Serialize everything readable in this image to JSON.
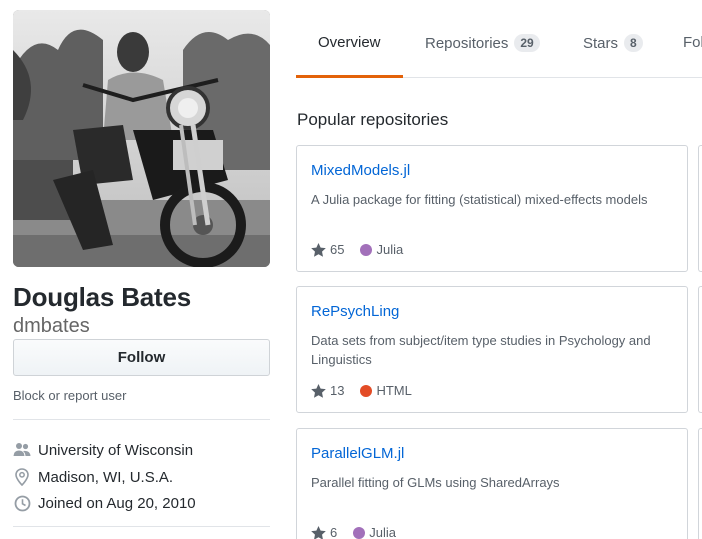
{
  "profile": {
    "full_name": "Douglas Bates",
    "username": "dmbates",
    "follow_label": "Follow",
    "block_label": "Block or report user",
    "details": [
      {
        "icon": "organization-icon",
        "text": "University of Wisconsin"
      },
      {
        "icon": "location-icon",
        "text": "Madison, WI, U.S.A."
      },
      {
        "icon": "clock-icon",
        "text": "Joined on Aug 20, 2010"
      }
    ]
  },
  "tabs": [
    {
      "label": "Overview",
      "selected": true
    },
    {
      "label": "Repositories",
      "count": "29"
    },
    {
      "label": "Stars",
      "count": "8"
    },
    {
      "label": "Fol"
    }
  ],
  "popular": {
    "title": "Popular repositories",
    "repos": [
      {
        "name": "MixedModels.jl",
        "description": "A Julia package for fitting (statistical) mixed-effects models",
        "stars": "65",
        "language": "Julia",
        "lang_color": "#a270ba"
      },
      {
        "name": "RePsychLing",
        "description": "Data sets from subject/item type studies in Psychology and Linguistics",
        "stars": "13",
        "language": "HTML",
        "lang_color": "#e34c26"
      },
      {
        "name": "ParallelGLM.jl",
        "description": "Parallel fitting of GLMs using SharedArrays",
        "stars": "6",
        "language": "Julia",
        "lang_color": "#a270ba"
      }
    ]
  },
  "colors": {
    "accent": "#e36209",
    "link": "#0366d6"
  }
}
